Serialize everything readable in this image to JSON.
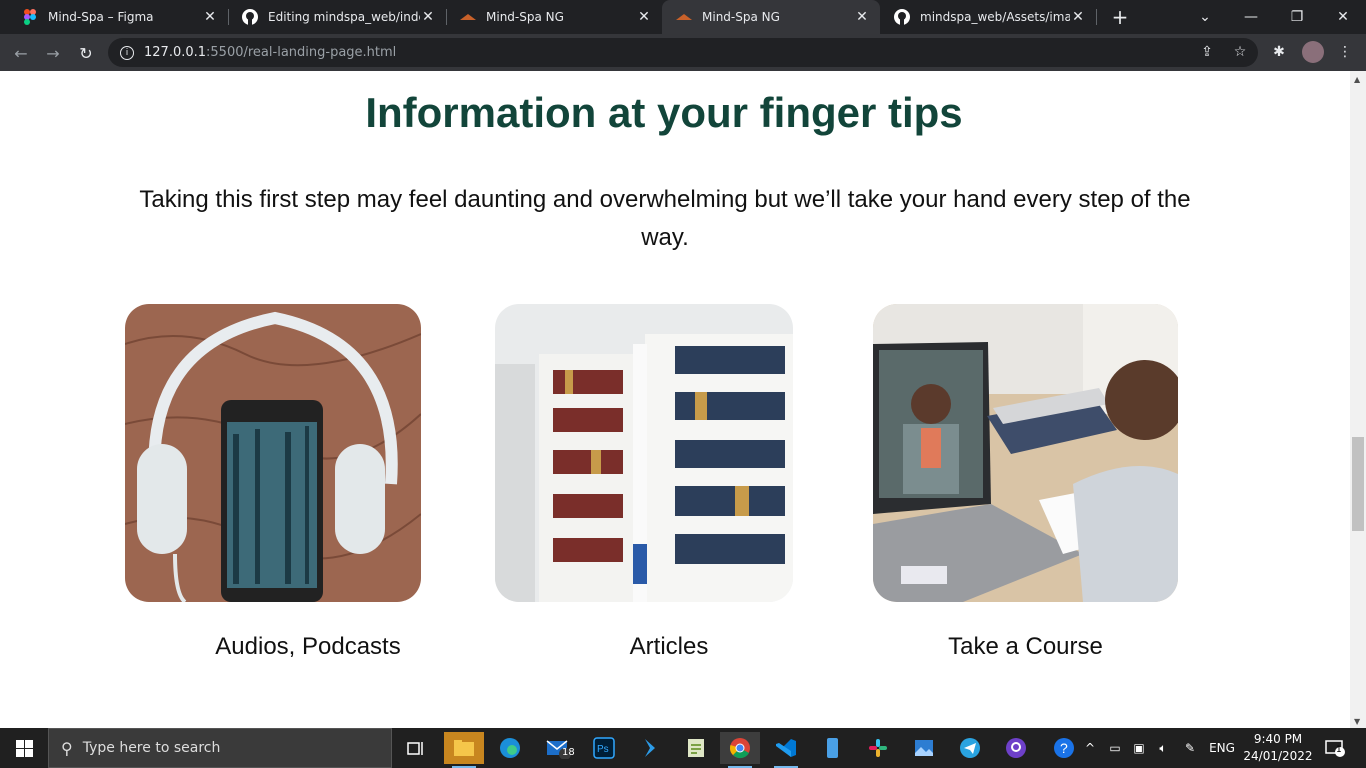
{
  "browser": {
    "tabs": [
      {
        "title": "Mind-Spa – Figma",
        "favicon": "figma-icon"
      },
      {
        "title": "Editing mindspa_web/index.h",
        "favicon": "github-icon"
      },
      {
        "title": "Mind-Spa NG",
        "favicon": "mindspa-icon"
      },
      {
        "title": "Mind-Spa NG",
        "favicon": "mindspa-icon",
        "active": true
      },
      {
        "title": "mindspa_web/Assets/images",
        "favicon": "github-icon"
      }
    ],
    "url_host": "127.0.0.1",
    "url_rest": ":5500/real-landing-page.html"
  },
  "page": {
    "heading": "Information at your finger tips",
    "lead": "Taking this first step may feel daunting and overwhelming but we’ll take your hand every step of the way.",
    "cards": [
      {
        "label": "Audios, Podcasts"
      },
      {
        "label": "Articles"
      },
      {
        "label": "Take a Course"
      }
    ]
  },
  "taskbar": {
    "search_placeholder": "Type here to search",
    "mail_badge": "18",
    "language": "ENG",
    "time": "9:40 PM",
    "date": "24/01/2022",
    "notification_count": "1"
  },
  "colors": {
    "heading": "#12453a",
    "chrome_dark": "#202124",
    "chrome_toolbar": "#35363a",
    "taskbar": "#202020"
  }
}
